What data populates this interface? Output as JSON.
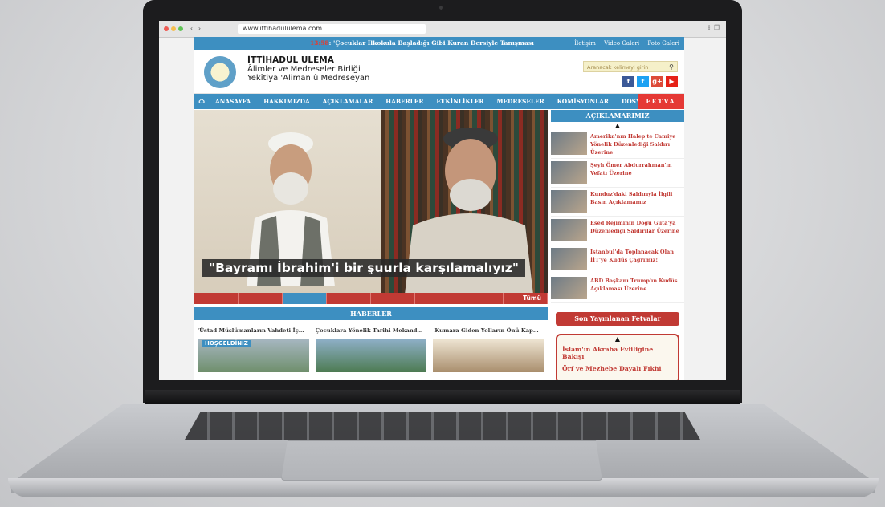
{
  "browser": {
    "url": "www.ittihadululema.com"
  },
  "site": {
    "ticker_time": "13:58",
    "ticker_text": ": 'Çocuklar İlkokula Başladığı Gibi Kuran Dersiyle Tanışması",
    "top_links": [
      "İletişim",
      "Video Galeri",
      "Foto Galeri"
    ],
    "logo_title": "İTTİHADUL ULEMA",
    "logo_line2": "Âlimler ve Medreseler Birliği",
    "logo_line3": "Yekîtiya 'Aliman û Medreseyan",
    "search_placeholder": "Aranacak kelimeyi girin",
    "social": [
      "f",
      "t",
      "g+",
      "▶"
    ],
    "social_colors": [
      "#3b5998",
      "#1da1f2",
      "#dd4b39",
      "#e62117"
    ]
  },
  "menu": {
    "items": [
      "ANASAYFA",
      "HAKKIMIZDA",
      "AÇIKLAMALAR",
      "HABERLER",
      "ETKİNLİKLER",
      "MEDRESELER",
      "KOMİSYONLAR",
      "DOSYA"
    ],
    "fetva": "FETVA"
  },
  "slider": {
    "caption": "\"Bayramı İbrahim'i bir şuurla karşılamalıyız\"",
    "all_label": "Tümü"
  },
  "aciklamalar": {
    "heading": "AÇIKLAMARIMIZ",
    "items": [
      "Amerika'nın Halep'te Camiye Yönelik Düzenlediği Saldırı Üzerine",
      "Şeyh Ömer Abdurrahman'ın Vefatı Üzerine",
      "Kunduz'daki Saldırıyla İlgili Basın Açıklamamız",
      "Esed Rejiminin Doğu Guta'ya Düzenlediği Saldırılar Üzerine",
      "İstanbul'da Toplanacak Olan İİT'ye Kudüs Çağrımız!",
      "ABD Başkanı Trump'ın Kudüs Açıklaması Üzerine"
    ]
  },
  "haberler": {
    "heading": "HABERLER",
    "items": [
      "'Üstad Müslümanların Vahdeti İç…",
      "Çocuklara Yönelik Tarihi Mekand…",
      "'Kumara Giden Yolların Önü Kap…"
    ],
    "badge": "HOŞGELDİNİZ"
  },
  "fetvalar": {
    "heading": "Son Yayınlanan Fetvalar",
    "items": [
      "İslam'ın Akraba Evliliğine Bakışı",
      "Örf ve Mezhebe Dayalı Fıkhi"
    ]
  }
}
